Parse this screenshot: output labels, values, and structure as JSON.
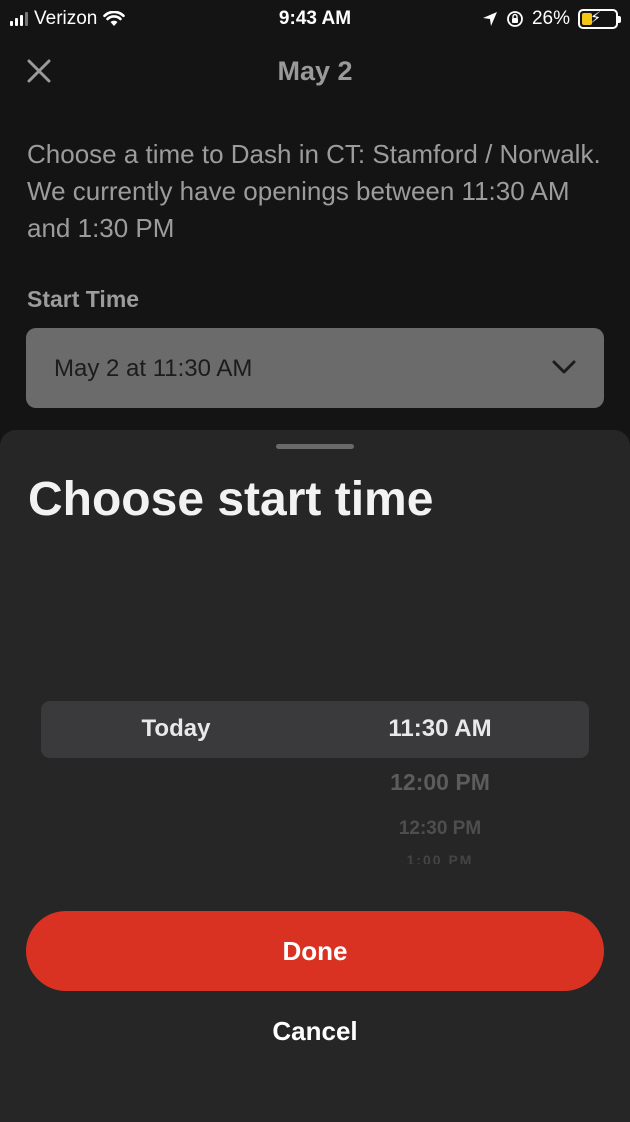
{
  "status_bar": {
    "carrier": "Verizon",
    "time": "9:43 AM",
    "battery": "26%"
  },
  "header": {
    "title": "May 2"
  },
  "intro": {
    "text": "Choose a time to Dash in CT: Stamford / Norwalk. We currently have openings between 11:30 AM and 1:30 PM"
  },
  "start_time": {
    "label": "Start Time",
    "value": "May 2 at 11:30 AM"
  },
  "sheet": {
    "title": "Choose start time",
    "picker": {
      "day_selected": "Today",
      "time_selected": "11:30 AM",
      "time_options": [
        "12:00 PM",
        "12:30 PM",
        "1:00 PM"
      ]
    },
    "done_label": "Done",
    "cancel_label": "Cancel"
  },
  "colors": {
    "accent": "#d93222",
    "sheet_background": "#262626",
    "battery_fill": "#f5c518"
  }
}
